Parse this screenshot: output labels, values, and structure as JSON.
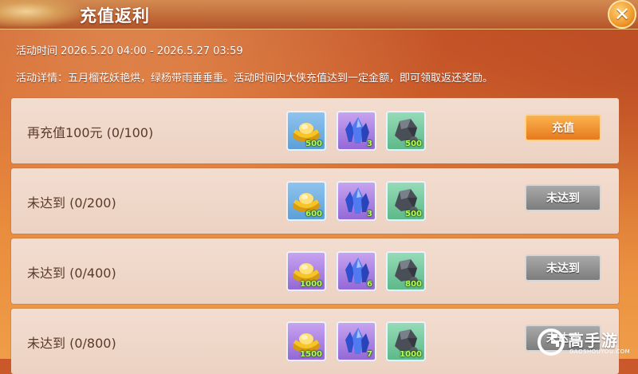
{
  "colors": {
    "charge_button": "#f08a2a",
    "disabled_button": "#8a8a8a",
    "count_text": "#b6ff5a"
  },
  "header": {
    "title": "充值返利",
    "close_icon": "close-icon"
  },
  "info": {
    "time": "活动时间  2026.5.20 04:00 - 2026.5.27 03:59",
    "details": "活动详情：五月榴花妖艳烘，绿杨带雨垂垂重。活动时间内大侠充值达到一定金额，即可领取返还奖励。"
  },
  "tiers": [
    {
      "label": "再充值100元 (0/100)",
      "button": "充值",
      "enabled": true,
      "rewards": [
        {
          "icon": "gold-ingot-icon",
          "frame": "blue",
          "count": "500"
        },
        {
          "icon": "blue-crystal-icon",
          "frame": "purple",
          "count": "3"
        },
        {
          "icon": "ore-stone-icon",
          "frame": "green",
          "count": "500"
        }
      ]
    },
    {
      "label": "未达到 (0/200)",
      "button": "未达到",
      "enabled": false,
      "rewards": [
        {
          "icon": "gold-ingot-icon",
          "frame": "blue",
          "count": "600"
        },
        {
          "icon": "blue-crystal-icon",
          "frame": "purple",
          "count": "3"
        },
        {
          "icon": "ore-stone-icon",
          "frame": "green",
          "count": "500"
        }
      ]
    },
    {
      "label": "未达到 (0/400)",
      "button": "未达到",
      "enabled": false,
      "rewards": [
        {
          "icon": "gold-ingot-icon",
          "frame": "purple",
          "count": "1000"
        },
        {
          "icon": "blue-crystal-icon",
          "frame": "purple",
          "count": "6"
        },
        {
          "icon": "ore-stone-icon",
          "frame": "green",
          "count": "800"
        }
      ]
    },
    {
      "label": "未达到 (0/800)",
      "button": "未达到",
      "enabled": false,
      "rewards": [
        {
          "icon": "gold-ingot-icon",
          "frame": "purple",
          "count": "1500"
        },
        {
          "icon": "blue-crystal-icon",
          "frame": "purple",
          "count": "7"
        },
        {
          "icon": "ore-stone-icon",
          "frame": "green",
          "count": "1000"
        }
      ]
    }
  ],
  "watermark": {
    "name": "高手游",
    "url": "GAOSHOUYOU.COM"
  }
}
